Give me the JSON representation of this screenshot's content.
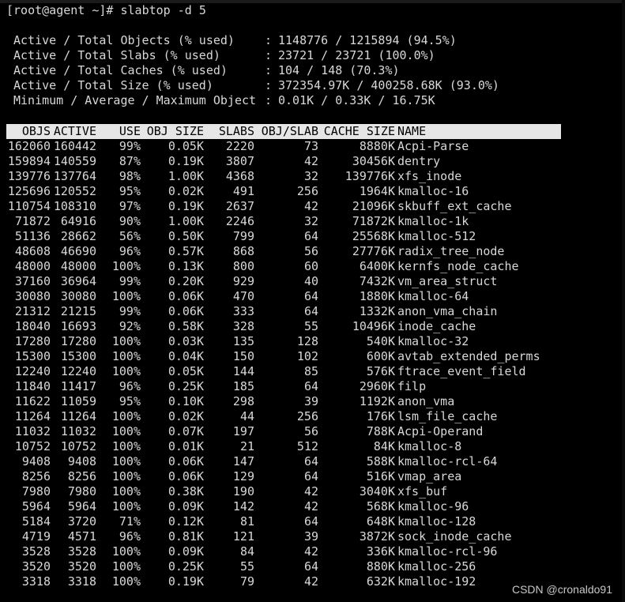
{
  "prompt": "[root@agent ~]# slabtop -d 5",
  "stats": [
    {
      "label": "Active / Total Objects (% used)",
      "value": "1148776 / 1215894 (94.5%)"
    },
    {
      "label": "Active / Total Slabs (% used)",
      "value": "23721 / 23721 (100.0%)"
    },
    {
      "label": "Active / Total Caches (% used)",
      "value": "104 / 148 (70.3%)"
    },
    {
      "label": "Active / Total Size (% used)",
      "value": "372354.97K / 400258.68K (93.0%)"
    },
    {
      "label": "Minimum / Average / Maximum Object",
      "value": "0.01K / 0.33K / 16.75K"
    }
  ],
  "columns": {
    "objs": "OBJS",
    "active": "ACTIVE",
    "use": "USE",
    "obj_size": "OBJ SIZE",
    "slabs": "SLABS",
    "obj_slab": "OBJ/SLAB",
    "cache_size": "CACHE SIZE",
    "name": "NAME"
  },
  "rows": [
    [
      "162060",
      "160442",
      "99%",
      "0.05K",
      "2220",
      "73",
      "8880K",
      "Acpi-Parse"
    ],
    [
      "159894",
      "140559",
      "87%",
      "0.19K",
      "3807",
      "42",
      "30456K",
      "dentry"
    ],
    [
      "139776",
      "137764",
      "98%",
      "1.00K",
      "4368",
      "32",
      "139776K",
      "xfs_inode"
    ],
    [
      "125696",
      "120552",
      "95%",
      "0.02K",
      "491",
      "256",
      "1964K",
      "kmalloc-16"
    ],
    [
      "110754",
      "108310",
      "97%",
      "0.19K",
      "2637",
      "42",
      "21096K",
      "skbuff_ext_cache"
    ],
    [
      "71872",
      "64916",
      "90%",
      "1.00K",
      "2246",
      "32",
      "71872K",
      "kmalloc-1k"
    ],
    [
      "51136",
      "28662",
      "56%",
      "0.50K",
      "799",
      "64",
      "25568K",
      "kmalloc-512"
    ],
    [
      "48608",
      "46690",
      "96%",
      "0.57K",
      "868",
      "56",
      "27776K",
      "radix_tree_node"
    ],
    [
      "48000",
      "48000",
      "100%",
      "0.13K",
      "800",
      "60",
      "6400K",
      "kernfs_node_cache"
    ],
    [
      "37160",
      "36964",
      "99%",
      "0.20K",
      "929",
      "40",
      "7432K",
      "vm_area_struct"
    ],
    [
      "30080",
      "30080",
      "100%",
      "0.06K",
      "470",
      "64",
      "1880K",
      "kmalloc-64"
    ],
    [
      "21312",
      "21215",
      "99%",
      "0.06K",
      "333",
      "64",
      "1332K",
      "anon_vma_chain"
    ],
    [
      "18040",
      "16693",
      "92%",
      "0.58K",
      "328",
      "55",
      "10496K",
      "inode_cache"
    ],
    [
      "17280",
      "17280",
      "100%",
      "0.03K",
      "135",
      "128",
      "540K",
      "kmalloc-32"
    ],
    [
      "15300",
      "15300",
      "100%",
      "0.04K",
      "150",
      "102",
      "600K",
      "avtab_extended_perms"
    ],
    [
      "12240",
      "12240",
      "100%",
      "0.05K",
      "144",
      "85",
      "576K",
      "ftrace_event_field"
    ],
    [
      "11840",
      "11417",
      "96%",
      "0.25K",
      "185",
      "64",
      "2960K",
      "filp"
    ],
    [
      "11622",
      "11059",
      "95%",
      "0.10K",
      "298",
      "39",
      "1192K",
      "anon_vma"
    ],
    [
      "11264",
      "11264",
      "100%",
      "0.02K",
      "44",
      "256",
      "176K",
      "lsm_file_cache"
    ],
    [
      "11032",
      "11032",
      "100%",
      "0.07K",
      "197",
      "56",
      "788K",
      "Acpi-Operand"
    ],
    [
      "10752",
      "10752",
      "100%",
      "0.01K",
      "21",
      "512",
      "84K",
      "kmalloc-8"
    ],
    [
      "9408",
      "9408",
      "100%",
      "0.06K",
      "147",
      "64",
      "588K",
      "kmalloc-rcl-64"
    ],
    [
      "8256",
      "8256",
      "100%",
      "0.06K",
      "129",
      "64",
      "516K",
      "vmap_area"
    ],
    [
      "7980",
      "7980",
      "100%",
      "0.38K",
      "190",
      "42",
      "3040K",
      "xfs_buf"
    ],
    [
      "5964",
      "5964",
      "100%",
      "0.09K",
      "142",
      "42",
      "568K",
      "kmalloc-96"
    ],
    [
      "5184",
      "3720",
      "71%",
      "0.12K",
      "81",
      "64",
      "648K",
      "kmalloc-128"
    ],
    [
      "4719",
      "4571",
      "96%",
      "0.81K",
      "121",
      "39",
      "3872K",
      "sock_inode_cache"
    ],
    [
      "3528",
      "3528",
      "100%",
      "0.09K",
      "84",
      "42",
      "336K",
      "kmalloc-rcl-96"
    ],
    [
      "3520",
      "3520",
      "100%",
      "0.25K",
      "55",
      "64",
      "880K",
      "kmalloc-256"
    ],
    [
      "3318",
      "3318",
      "100%",
      "0.19K",
      "79",
      "42",
      "632K",
      "kmalloc-192"
    ]
  ],
  "watermark": "CSDN @cronaldo91",
  "colors": {
    "background": "#000000",
    "text": "#d8d8d8",
    "header_bg": "#e6e6e6",
    "header_text": "#000000"
  }
}
